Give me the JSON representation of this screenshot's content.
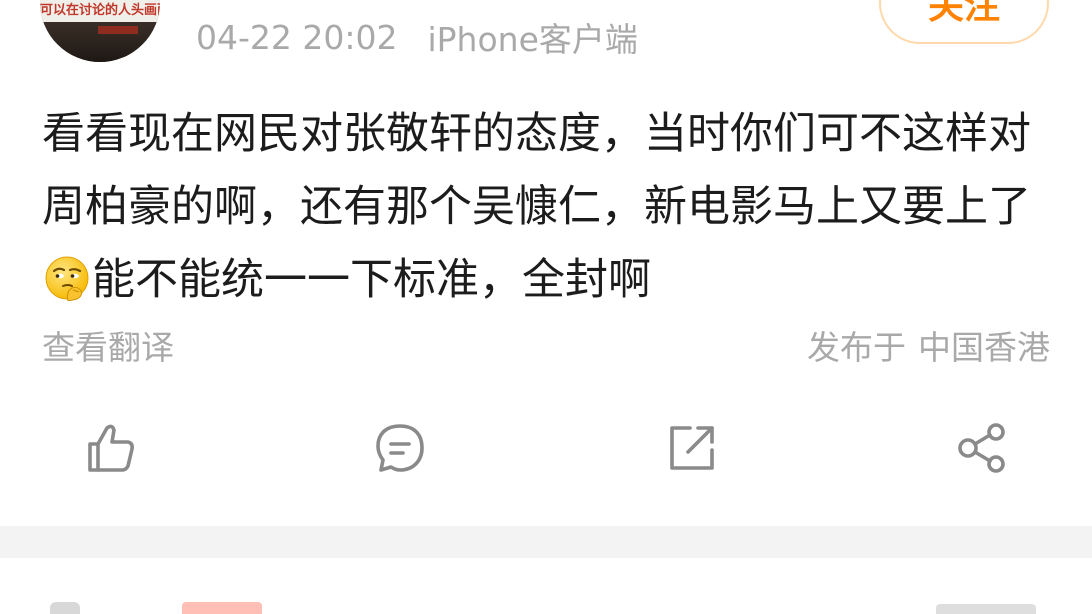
{
  "post": {
    "meta": {
      "time": "04-22 20:02",
      "client": "iPhone客户端"
    },
    "follow_label": "关注",
    "avatar_banner_text": "可以在讨论的人头画面",
    "text_part1": "看看现在网民对张敬轩的态度，当时你们可不这样对周柏豪的啊，还有那个吴慷仁，新电影马上又要上了",
    "emoji_name": "thinking-face-emoji",
    "text_part2": "能不能统一一下标准，全封啊",
    "translate_label": "查看翻译",
    "location_prefix": "发布于",
    "location": "中国香港"
  },
  "actions": [
    {
      "name": "like",
      "icon": "thumbs-up-icon"
    },
    {
      "name": "comment",
      "icon": "comment-bubble-icon"
    },
    {
      "name": "repost",
      "icon": "repost-icon"
    },
    {
      "name": "share",
      "icon": "share-icon"
    }
  ],
  "colors": {
    "accent_orange": "#ff8200",
    "follow_border": "#ffd9ab",
    "meta_gray": "#a9a9a9",
    "text_dark": "#1c1c1c",
    "icon_gray": "#8a8a8a",
    "divider": "#f3f3f3"
  }
}
